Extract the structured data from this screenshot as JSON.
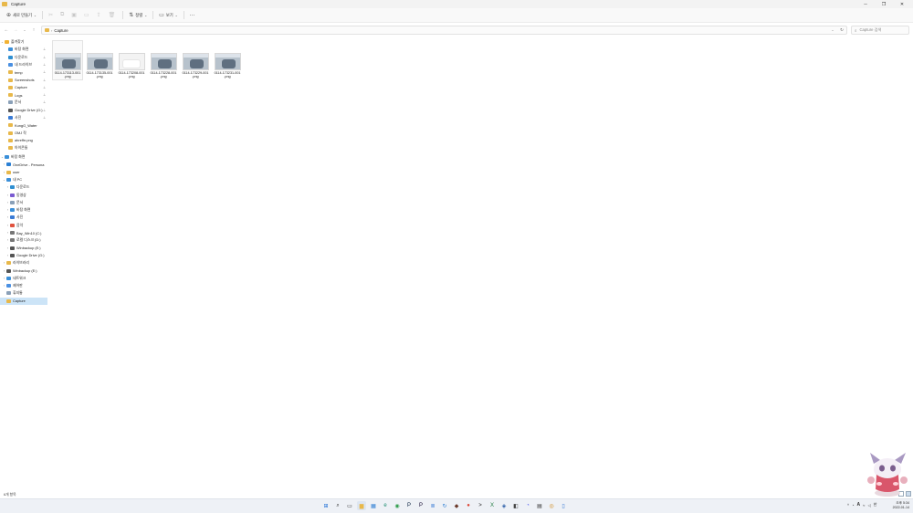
{
  "window": {
    "title": "Capture",
    "controls": {
      "minimize": "─",
      "maximize": "❐",
      "close": "✕"
    }
  },
  "commandbar": {
    "new_label": "새로 만들기",
    "sort_label": "정렬",
    "view_label": "보기",
    "more": "···"
  },
  "address": {
    "path": [
      "Capture"
    ],
    "search_placeholder": "Capture 검색"
  },
  "nav": {
    "quick_access": "즐겨찾기",
    "quick_items": [
      {
        "label": "바탕 화면",
        "pinned": true,
        "color": "#3a8fd9"
      },
      {
        "label": "다운로드",
        "pinned": true,
        "color": "#2f8fd1"
      },
      {
        "label": "내 드라이브",
        "pinned": true,
        "color": "#4a90e2"
      },
      {
        "label": "temp",
        "pinned": true,
        "color": "#e8b84a"
      },
      {
        "label": "Screenshots",
        "pinned": true,
        "color": "#e8b84a"
      },
      {
        "label": "Capture",
        "pinned": true,
        "color": "#e8b84a"
      },
      {
        "label": "Logs",
        "pinned": true,
        "color": "#e8b84a"
      },
      {
        "label": "문서",
        "pinned": true,
        "color": "#8aa0b8"
      },
      {
        "label": "Google Drive (G:)",
        "pinned": true,
        "color": "#555555"
      },
      {
        "label": "사진",
        "pinned": true,
        "color": "#3a7bd5"
      },
      {
        "label": "KungG_Water",
        "pinned": false,
        "color": "#e8b84a"
      },
      {
        "label": "OMJ 작",
        "pinned": false,
        "color": "#e8b84a"
      },
      {
        "label": "ahreffrr.png",
        "pinned": false,
        "color": "#e8b84a"
      },
      {
        "label": "아이콘들",
        "pinned": false,
        "color": "#e8b84a"
      }
    ],
    "network_root": "바탕 화면",
    "root_items": [
      {
        "label": "OneDrive - Persona",
        "color": "#2a7fd4"
      },
      {
        "label": "user",
        "color": "#e8b84a"
      }
    ],
    "pc_label": "내 PC",
    "pc_items": [
      {
        "label": "다운로드",
        "color": "#2f8fd1"
      },
      {
        "label": "동영상",
        "color": "#7a5bd1"
      },
      {
        "label": "문서",
        "color": "#8aa0b8"
      },
      {
        "label": "바탕 화면",
        "color": "#3a8fd9"
      },
      {
        "label": "사진",
        "color": "#3a7bd5"
      },
      {
        "label": "음악",
        "color": "#e0533f"
      },
      {
        "label": "Bay_Win10 (C:)",
        "color": "#777777"
      },
      {
        "label": "로컬 디스크 (D:)",
        "color": "#777777"
      },
      {
        "label": "Winbackup (E:)",
        "color": "#555555"
      },
      {
        "label": "Google Drive (G:)",
        "color": "#555555"
      }
    ],
    "tail_items": [
      {
        "label": "라이브러리",
        "color": "#e8b84a"
      },
      {
        "label": "Winbackup (E:)",
        "color": "#555555"
      },
      {
        "label": "네트워크",
        "color": "#3a8fd9"
      },
      {
        "label": "제어판",
        "color": "#4a90e2"
      },
      {
        "label": "휴지통",
        "color": "#8aa0b8"
      },
      {
        "label": "Capture",
        "color": "#e8b84a"
      }
    ]
  },
  "files": [
    {
      "line1": "0114-173113-001",
      "line2": ".png",
      "style": "photo"
    },
    {
      "line1": "0114-173135-001",
      "line2": ".png",
      "style": "photo"
    },
    {
      "line1": "0114-173208-001",
      "line2": ".png",
      "style": "white"
    },
    {
      "line1": "0114-173228-001",
      "line2": ".png",
      "style": "photo"
    },
    {
      "line1": "0114-173229-001",
      "line2": ".png",
      "style": "photo"
    },
    {
      "line1": "0114-173231-001",
      "line2": ".png",
      "style": "photo"
    }
  ],
  "status": {
    "count": "6개 항목"
  },
  "taskbar": {
    "apps": [
      {
        "name": "start-icon",
        "color": "#1f6fd6",
        "glyph": "⊞"
      },
      {
        "name": "search-icon",
        "color": "#333333",
        "glyph": "⌕"
      },
      {
        "name": "taskview-icon",
        "color": "#333333",
        "glyph": "▭"
      },
      {
        "name": "explorer-icon",
        "color": "#e8b84a",
        "glyph": "▆",
        "active": true
      },
      {
        "name": "widgets-icon",
        "color": "#2f7fd4",
        "glyph": "▦"
      },
      {
        "name": "edge-icon",
        "color": "#1a8c6e",
        "glyph": "e"
      },
      {
        "name": "chrome-icon",
        "color": "#2e9c4a",
        "glyph": "◉"
      },
      {
        "name": "photoshop-icon",
        "color": "#0b2340",
        "glyph": "P"
      },
      {
        "name": "premiere-icon",
        "color": "#1a1035",
        "glyph": "P"
      },
      {
        "name": "notepad-icon",
        "color": "#3a7bd5",
        "glyph": "≣"
      },
      {
        "name": "refresh-app-icon",
        "color": "#2e7fd2",
        "glyph": "↻"
      },
      {
        "name": "app-icon-1",
        "color": "#6b3a2a",
        "glyph": "◆"
      },
      {
        "name": "app-icon-2",
        "color": "#d43",
        "glyph": "●"
      },
      {
        "name": "terminal-icon",
        "color": "#222222",
        "glyph": ">"
      },
      {
        "name": "excel-icon",
        "color": "#1f7a3f",
        "glyph": "X"
      },
      {
        "name": "app-icon-3",
        "color": "#2b5ea7",
        "glyph": "◈"
      },
      {
        "name": "app-icon-4",
        "color": "#444444",
        "glyph": "◧"
      },
      {
        "name": "discord-icon",
        "color": "#5865f2",
        "glyph": "◔"
      },
      {
        "name": "app-icon-5",
        "color": "#333333",
        "glyph": "▤"
      },
      {
        "name": "app-icon-6",
        "color": "#d08a1e",
        "glyph": "◎"
      },
      {
        "name": "app-icon-7",
        "color": "#3a7bd5",
        "glyph": "▯"
      }
    ],
    "tray": {
      "ime": "A",
      "lang": "한"
    },
    "clock": {
      "time": "오후 5:34",
      "date": "2022-01-14"
    }
  }
}
